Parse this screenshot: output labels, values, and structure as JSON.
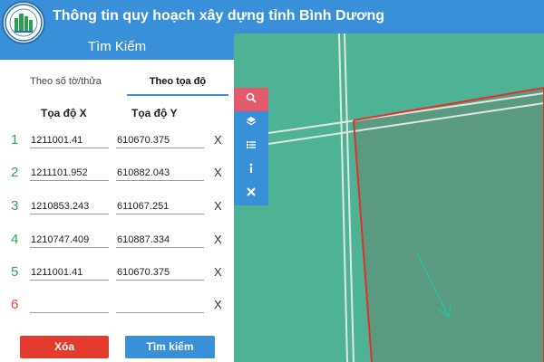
{
  "header": {
    "title": "Thông tin quy hoạch xây dựng tỉnh Bình Dương"
  },
  "panel": {
    "title": "Tìm Kiếm",
    "tabs": [
      {
        "label": "Theo số tờ/thửa",
        "active": false
      },
      {
        "label": "Theo tọa độ",
        "active": true
      }
    ],
    "columns": {
      "x": "Tọa độ X",
      "y": "Tọa độ Y"
    },
    "rows": [
      {
        "num": "1",
        "x": "1211001.41",
        "y": "610670.375",
        "remove": "X"
      },
      {
        "num": "2",
        "x": "1211101.952",
        "y": "610882.043",
        "remove": "X"
      },
      {
        "num": "3",
        "x": "1210853.243",
        "y": "611067.251",
        "remove": "X"
      },
      {
        "num": "4",
        "x": "1210747.409",
        "y": "610887.334",
        "remove": "X"
      },
      {
        "num": "5",
        "x": "1211001.41",
        "y": "610670.375",
        "remove": "X"
      },
      {
        "num": "6",
        "x": "",
        "y": "",
        "remove": "X"
      }
    ],
    "buttons": {
      "delete": "Xóa",
      "search": "Tìm kiếm"
    }
  },
  "toolbar": [
    {
      "icon": "search-icon",
      "active": true
    },
    {
      "icon": "layers-icon",
      "active": false
    },
    {
      "icon": "list-icon",
      "active": false
    },
    {
      "icon": "info-icon",
      "active": false
    },
    {
      "icon": "close-icon",
      "active": false
    }
  ],
  "colors": {
    "header": "#3a8fd9",
    "map": "#4db394",
    "parcel_border": "#e0302a",
    "active_tool": "#e25a6b",
    "delete_button": "#e33b2e"
  }
}
